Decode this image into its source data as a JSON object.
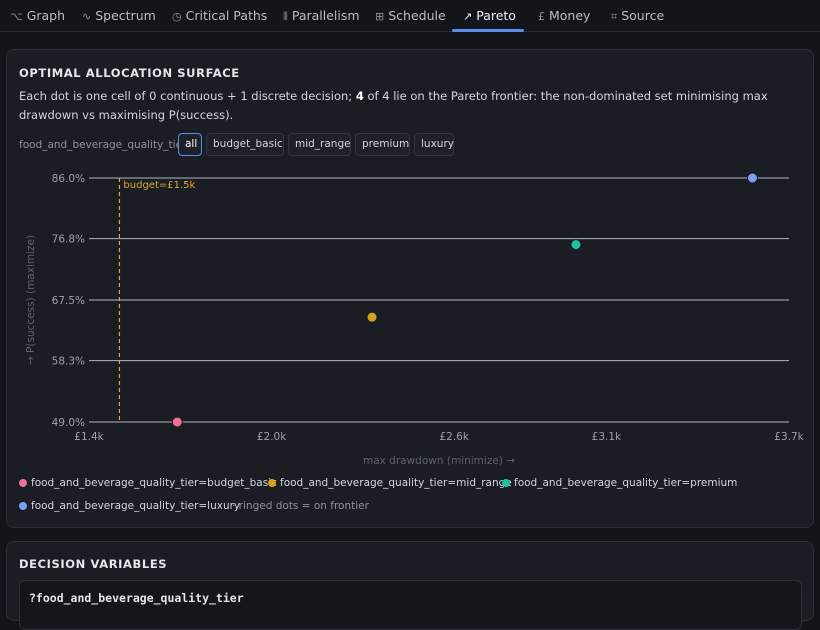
{
  "tabs": [
    {
      "icon": "⌥",
      "label": "Graph",
      "active": false
    },
    {
      "icon": "∿",
      "label": "Spectrum",
      "active": false
    },
    {
      "icon": "◷",
      "label": "Critical Paths",
      "active": false
    },
    {
      "icon": "⦀",
      "label": "Parallelism",
      "active": false
    },
    {
      "icon": "⊞",
      "label": "Schedule",
      "active": false
    },
    {
      "icon": "↗",
      "label": "Pareto",
      "active": true
    },
    {
      "icon": "£",
      "label": "Money",
      "active": false
    },
    {
      "icon": "⌗",
      "label": "Source",
      "active": false
    }
  ],
  "surface": {
    "title": "OPTIMAL ALLOCATION SURFACE",
    "desc_1": "Each dot is one cell of 0 continuous + 1 discrete decision; ",
    "desc_count": "4",
    "desc_2": " of 4 lie on the Pareto frontier: the non-dominated set minimising max drawdown vs maximising P(success).",
    "filter_label": "food_and_beverage_quality_tier",
    "filters": [
      {
        "label": "all",
        "active": true
      },
      {
        "label": "budget_basic",
        "active": false
      },
      {
        "label": "mid_range",
        "active": false
      },
      {
        "label": "premium",
        "active": false
      },
      {
        "label": "luxury",
        "active": false
      }
    ],
    "legend_note": "· ringed dots = on frontier"
  },
  "chart_data": {
    "type": "scatter",
    "xlabel": "max drawdown (minimize) →",
    "ylabel": "→ P(success) (maximize)",
    "xlim": [
      1400,
      3700
    ],
    "ylim": [
      49.0,
      86.0
    ],
    "x_ticks": [
      1400,
      2000,
      2600,
      3100,
      3700
    ],
    "x_tick_labels": [
      "£1.4k",
      "£2.0k",
      "£2.6k",
      "£3.1k",
      "£3.7k"
    ],
    "y_ticks": [
      49.0,
      58.3,
      67.5,
      76.8,
      86.0
    ],
    "y_tick_labels": [
      "49.0%",
      "58.3%",
      "67.5%",
      "76.8%",
      "86.0%"
    ],
    "grid": true,
    "budget_line": {
      "x": 1500,
      "label": "budget=£1.5k",
      "color": "#e0a82e"
    },
    "series": [
      {
        "name": "food_and_beverage_quality_tier=budget_basic",
        "color": "#f0709a",
        "points": [
          {
            "x": 1690,
            "y": 49.0
          }
        ]
      },
      {
        "name": "food_and_beverage_quality_tier=mid_range",
        "color": "#d6a21e",
        "points": [
          {
            "x": 2330,
            "y": 64.9
          }
        ]
      },
      {
        "name": "food_and_beverage_quality_tier=premium",
        "color": "#1fc0a0",
        "points": [
          {
            "x": 3000,
            "y": 75.9
          }
        ]
      },
      {
        "name": "food_and_beverage_quality_tier=luxury",
        "color": "#7b9ff2",
        "points": [
          {
            "x": 3580,
            "y": 86.0
          }
        ]
      }
    ]
  },
  "decision": {
    "title": "DECISION VARIABLES",
    "var_name": "?food_and_beverage_quality_tier"
  },
  "colors": {
    "accent": "#5b8def",
    "grid": "#d4d7dd"
  }
}
